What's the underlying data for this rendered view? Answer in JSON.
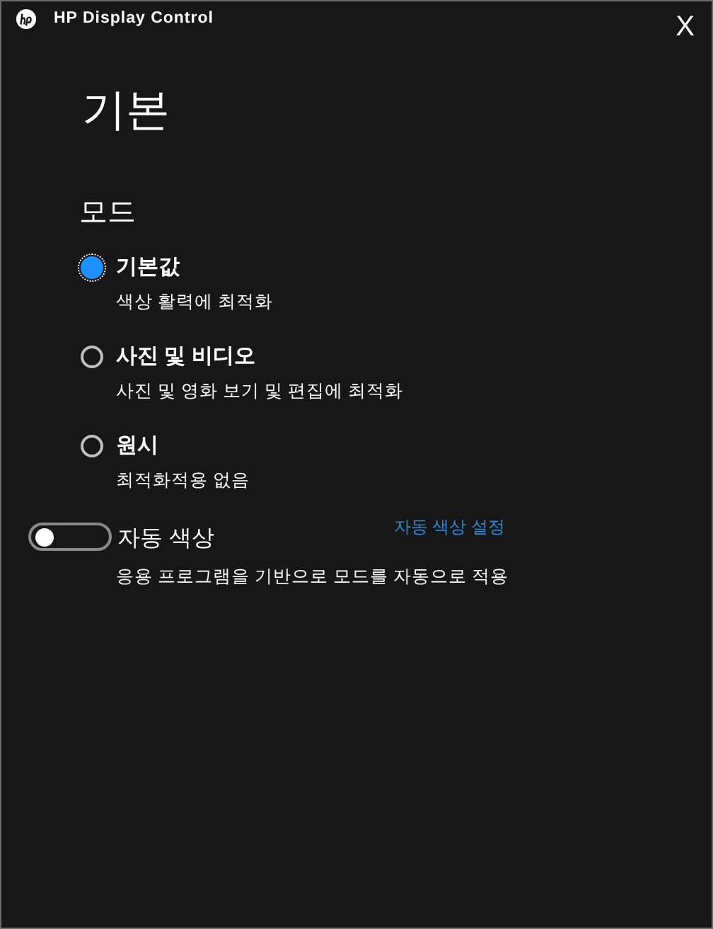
{
  "window": {
    "title": "HP Display Control",
    "close": "X"
  },
  "page_title": "기본",
  "section_title": "모드",
  "modes": [
    {
      "label": "기본값",
      "description": "색상 활력에 최적화",
      "selected": true
    },
    {
      "label": "사진 및 비디오",
      "description": "사진 및 영화 보기 및 편집에 최적화",
      "selected": false
    },
    {
      "label": "원시",
      "description": "최적화적용 없음",
      "selected": false
    }
  ],
  "auto_color": {
    "label": "자동 색상",
    "on": false,
    "link": "자동 색상 설정",
    "description": "응용 프로그램을 기반으로 모드를 자동으로 적용"
  }
}
